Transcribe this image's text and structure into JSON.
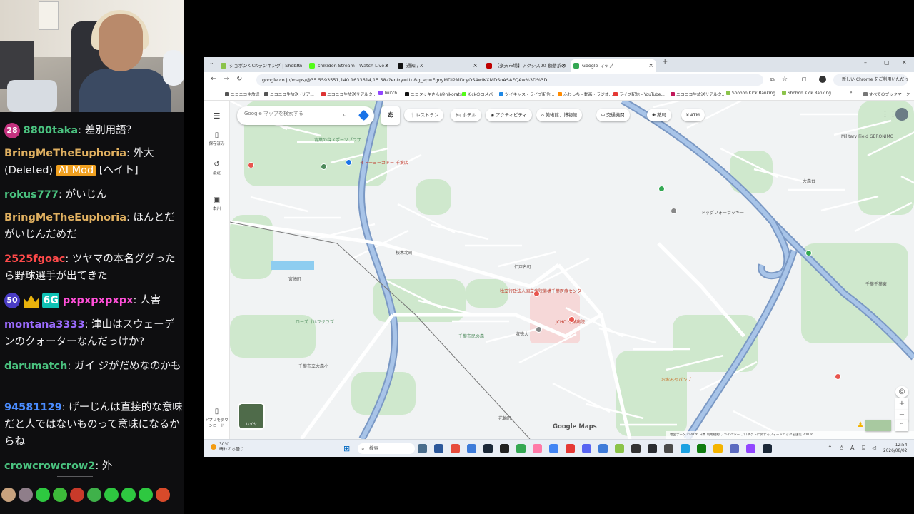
{
  "stream": {
    "chat": [
      {
        "badge": "28",
        "user": "8800taka",
        "color": "#4ac27f",
        "text": ": 差別用語？"
      },
      {
        "user": "BringMeTheEuphoria",
        "color": "#e0b060",
        "text": ": 外大 (Deleted)",
        "mod": "AI Mod",
        "tail": "[ヘイト]"
      },
      {
        "user": "rokus777",
        "color": "#4ac27f",
        "text": ": がいじん"
      },
      {
        "user": "BringMeTheEuphoria",
        "color": "#e0b060",
        "text": ": ほんとだがいじんだめだ"
      },
      {
        "user": "2525fgoac",
        "color": "#ff4a4a",
        "text": ": ツヤマの本名ググったら野球選手が出てきた"
      },
      {
        "badge": "50",
        "user": "pxpxpxpxpx",
        "color": "#ff4fd8",
        "text": ": 人害"
      },
      {
        "user": "montana3333",
        "color": "#9b6bff",
        "text": ": 津山はスウェーデンのクォーターなんだっけか?"
      },
      {
        "user": "darumatch",
        "color": "#4ac27f",
        "text": ": ガイ ジがだめなのかも"
      },
      {
        "user": "94581129",
        "color": "#4a8cff",
        "text": ": げーじんは直接的な意味だと人ではないものって意味になるからね"
      },
      {
        "user": "crowcrowcrow2",
        "color": "#4ac27f",
        "text": ": 外"
      }
    ]
  },
  "browser": {
    "tabs": [
      {
        "title": "ショボンKICKランキング | Shobon K",
        "fav": "#8bc34a",
        "active": false
      },
      {
        "title": "shikidon Stream - Watch Live o",
        "fav": "#53fc18",
        "active": false
      },
      {
        "title": "通知 / X",
        "fav": "#111111",
        "active": false
      },
      {
        "title": "【楽天市場】アクシス90 動動系の",
        "fav": "#bf0000",
        "active": false
      },
      {
        "title": "Google マップ",
        "fav": "#34a853",
        "active": true
      }
    ],
    "new_tab": "+",
    "url": "google.co.jp/maps/@35.5593551,140.1633614,15.58z?entry=ttu&g_ep=EgoyMDI2MDcyOS4wIKXMDSoASAFQAw%3D%3D",
    "update_btn": "新しい Chrome をご利用いただけます",
    "bookmarks": [
      {
        "label": "ニコニコ生放送",
        "color": "#555"
      },
      {
        "label": "ニコニコ生放送 (リア...",
        "color": "#555"
      },
      {
        "label": "ニコニコ生放送リアルタ...",
        "color": "#d33"
      },
      {
        "label": "Twitch",
        "color": "#9146ff"
      },
      {
        "label": "ニコタッキさん(@nikorats...",
        "color": "#111"
      },
      {
        "label": "Kickのコメバ",
        "color": "#53fc18"
      },
      {
        "label": "ツイキャス - ライブ配信...",
        "color": "#1e88e5"
      },
      {
        "label": "ふわっち - 動画・ラジオ...",
        "color": "#ff8a00"
      },
      {
        "label": "ライブ配信 - YouTube...",
        "color": "#e53935"
      },
      {
        "label": "ニコニコ生放送リアルタ...",
        "color": "#c2185b"
      },
      {
        "label": "Shobon Kick Ranking",
        "color": "#8bc34a"
      },
      {
        "label": "Shobon Kick Ranking",
        "color": "#8bc34a"
      },
      {
        "label": "すべてのブックマーク",
        "color": "#777"
      }
    ]
  },
  "maps": {
    "search_placeholder": "Google マップを検索する",
    "ime": "あ",
    "chips": [
      "レストラン",
      "ホテル",
      "アクティビティ",
      "美術館、博物館",
      "交通機関",
      "薬局",
      "ATM"
    ],
    "rail": [
      {
        "label": "保存済み",
        "icon": "bookmark-icon",
        "glyph": "▯"
      },
      {
        "label": "最近",
        "icon": "history-icon",
        "glyph": "↺"
      },
      {
        "label": "本州",
        "icon": "recent-map-icon",
        "glyph": "▣"
      },
      {
        "label": "アプリをダウンロード",
        "icon": "phone-icon",
        "glyph": "▯"
      }
    ],
    "layer_label": "レイヤ",
    "logo": "Google Maps",
    "footer": "地図データ ©2026   日本   利用規約   プライバシー   プロダクトに関するフィードバックを送信   200 m",
    "places": [
      {
        "name": "青葉の森スポーツプラザ",
        "color": "#4d8a5b"
      },
      {
        "name": "イトーヨーカドー 千葉店",
        "color": "#c0392b"
      },
      {
        "name": "ドッグフォーラッキー",
        "color": "#555"
      },
      {
        "name": "桜木北町",
        "color": "#555"
      },
      {
        "name": "仁戸名町",
        "color": "#555"
      },
      {
        "name": "独立行政法人国立病院機構千葉医療センター",
        "color": "#c0392b"
      },
      {
        "name": "JCHO 千葉病院",
        "color": "#c0392b"
      },
      {
        "name": "千葉市立大森小",
        "color": "#555"
      },
      {
        "name": "花輪町",
        "color": "#555"
      },
      {
        "name": "おおみやパンプ",
        "color": "#c86b23"
      },
      {
        "name": "Military Field GERONIMO",
        "color": "#555"
      },
      {
        "name": "千葉千葉東",
        "color": "#555"
      },
      {
        "name": "大森台",
        "color": "#555"
      },
      {
        "name": "宮崎町",
        "color": "#555"
      },
      {
        "name": "ローズゴルフクラブ",
        "color": "#4d8a5b"
      },
      {
        "name": "千葉市民の森",
        "color": "#4d8a5b"
      },
      {
        "name": "淑徳大",
        "color": "#555"
      }
    ]
  },
  "taskbar": {
    "temp": "30°C",
    "weather": "晴れのち曇り",
    "search": "検索",
    "time": "12:54",
    "date": "2026/08/02"
  }
}
